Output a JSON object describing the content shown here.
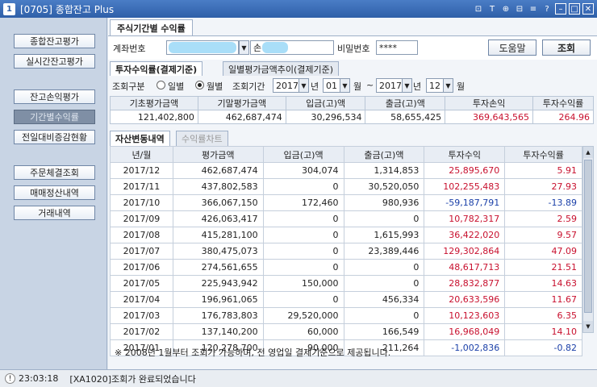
{
  "window": {
    "app_icon": "1",
    "title": "[0705] 종합잔고 Plus"
  },
  "titlebar_icons": [
    "grid-icon",
    "font-icon",
    "copy-icon",
    "share-icon",
    "list-icon",
    "help-icon",
    "minimize-icon",
    "maximize-icon",
    "close-icon"
  ],
  "titlebar_glyphs": [
    "⊡",
    "T",
    "⊕",
    "⊟",
    "≡",
    "?",
    "–",
    "□",
    "✕"
  ],
  "sidebar": {
    "buttons": [
      "종합잔고평가",
      "실시간잔고평가",
      "잔고손익평가",
      "기간별수익률",
      "전일대비증감현황",
      "주문체결조회",
      "매매정산내역",
      "거래내역"
    ],
    "active_index": 3
  },
  "top_tab": "주식기간별 수익률",
  "account": {
    "label": "계좌번호",
    "name_prefix": "손",
    "password_label": "비밀번호",
    "password_value": "****",
    "help_button": "도움말",
    "query_button": "조회"
  },
  "sub_tabs": [
    "투자수익률(결제기준)",
    "일별평가금액추이(결제기준)"
  ],
  "filter": {
    "type_label": "조회구분",
    "daily_label": "일별",
    "monthly_label": "월별",
    "selected": "월별",
    "period_label": "조회기간",
    "start_year": "2017",
    "year_unit": "년",
    "start_month": "01",
    "month_unit": "월",
    "tilde": "~",
    "end_year": "2017",
    "end_month": "12"
  },
  "summary": {
    "headers": [
      "기초평가금액",
      "기말평가금액",
      "입금(고)액",
      "출금(고)액",
      "투자손익",
      "투자수익률"
    ],
    "values": [
      "121,402,800",
      "462,687,474",
      "30,296,534",
      "58,655,425",
      "369,643,565",
      "264.96"
    ]
  },
  "detail_tabs": [
    "자산변동내역",
    "수익률차트"
  ],
  "table": {
    "headers": [
      "년/월",
      "평가금액",
      "입금(고)액",
      "출금(고)액",
      "투자수익",
      "투자수익률"
    ],
    "rows": [
      [
        "2017/12",
        "462,687,474",
        "304,074",
        "1,314,853",
        "25,895,670",
        "5.91"
      ],
      [
        "2017/11",
        "437,802,583",
        "0",
        "30,520,050",
        "102,255,483",
        "27.93"
      ],
      [
        "2017/10",
        "366,067,150",
        "172,460",
        "980,936",
        "-59,187,791",
        "-13.89"
      ],
      [
        "2017/09",
        "426,063,417",
        "0",
        "0",
        "10,782,317",
        "2.59"
      ],
      [
        "2017/08",
        "415,281,100",
        "0",
        "1,615,993",
        "36,422,020",
        "9.57"
      ],
      [
        "2017/07",
        "380,475,073",
        "0",
        "23,389,446",
        "129,302,864",
        "47.09"
      ],
      [
        "2017/06",
        "274,561,655",
        "0",
        "0",
        "48,617,713",
        "21.51"
      ],
      [
        "2017/05",
        "225,943,942",
        "150,000",
        "0",
        "28,832,877",
        "14.63"
      ],
      [
        "2017/04",
        "196,961,065",
        "0",
        "456,334",
        "20,633,596",
        "11.67"
      ],
      [
        "2017/03",
        "176,783,803",
        "29,520,000",
        "0",
        "10,123,603",
        "6.35"
      ],
      [
        "2017/02",
        "137,140,200",
        "60,000",
        "166,549",
        "16,968,049",
        "14.10"
      ],
      [
        "2017/01",
        "120,278,700",
        "90,000",
        "211,264",
        "-1,002,836",
        "-0.82"
      ]
    ]
  },
  "note": "※ 2008년 1월부터 조회가 가능하며, 전 영업일 결제기준으로 제공됩니다.",
  "status": {
    "time": "23:03:18",
    "message": "[XA1020]조회가 완료되었습니다"
  },
  "colors": {
    "positive": "#c8102e",
    "negative": "#1a3fa8",
    "title_bar": "#2f5fa8"
  }
}
